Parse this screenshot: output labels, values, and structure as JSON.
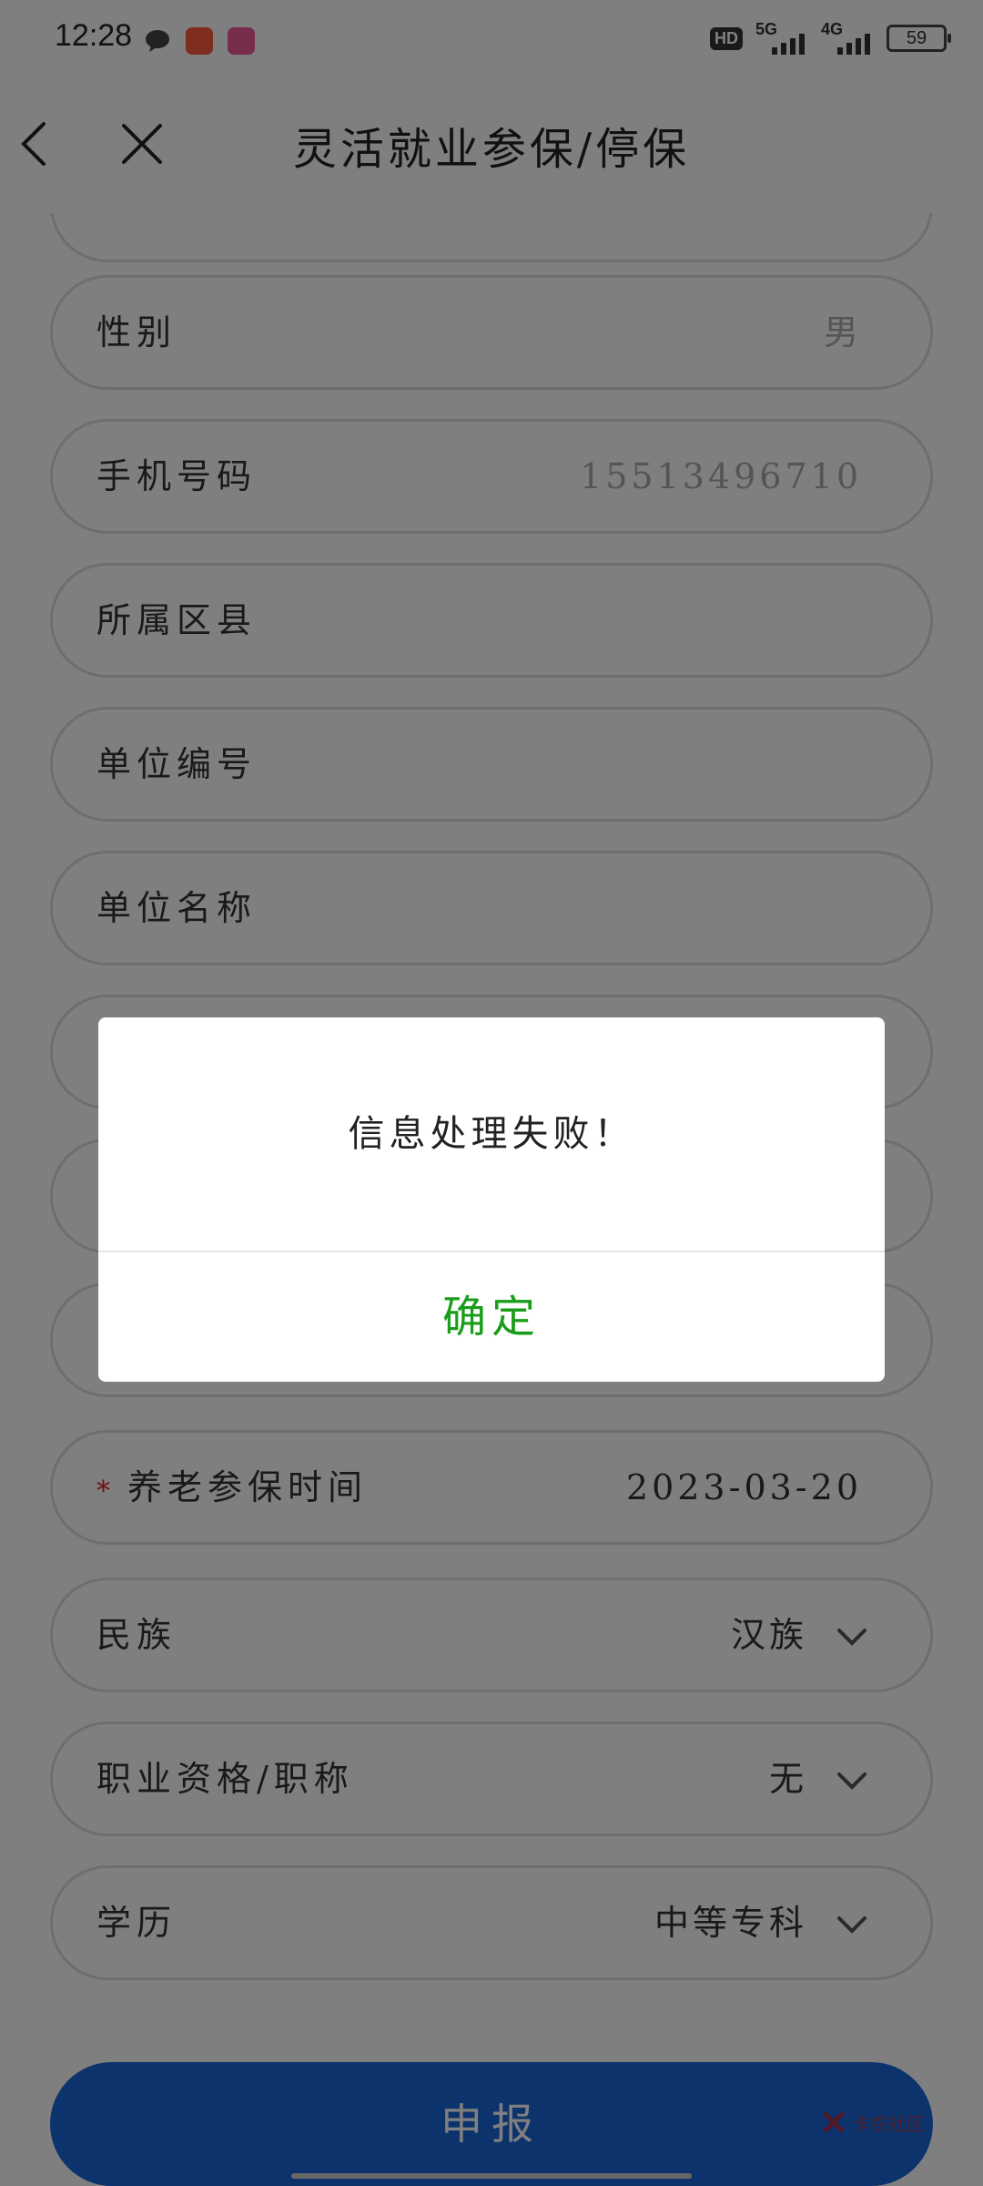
{
  "status_bar": {
    "time": "12:28",
    "network_1": "5G",
    "network_2": "4G",
    "hd_label": "HD",
    "battery": "59"
  },
  "header": {
    "title": "灵活就业参保/停保"
  },
  "form": {
    "fields": [
      {
        "label": "性别",
        "value": "男"
      },
      {
        "label": "手机号码",
        "value": "15513496710"
      },
      {
        "label": "所属区县",
        "value": ""
      },
      {
        "label": "单位编号",
        "value": ""
      },
      {
        "label": "单位名称",
        "value": ""
      },
      {
        "label": "养老参保时间",
        "value": "2023-03-20",
        "required_mark": "*"
      },
      {
        "label": "民族",
        "value": "汉族"
      },
      {
        "label": "职业资格/职称",
        "value": "无"
      },
      {
        "label": "学历",
        "value": "中等专科"
      }
    ],
    "submit_label": "申报"
  },
  "dialog": {
    "message": "信息处理失败！",
    "confirm_label": "确定"
  },
  "watermark": {
    "text": "卡农社区"
  },
  "colors": {
    "primary_blue": "#1a66d8",
    "confirm_green": "#1a9d1a",
    "required_red": "#e02020",
    "overlay": "rgba(0,0,0,0.5)"
  }
}
